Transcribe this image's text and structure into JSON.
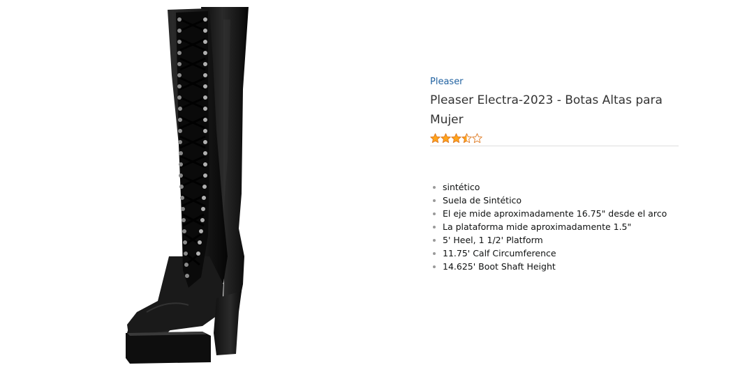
{
  "product": {
    "brand": "Pleaser",
    "title": "Pleaser Electra-2023 - Botas Altas para Mujer",
    "rating": 3.5,
    "rating_max": 5,
    "star_color": "#ffa41c",
    "image_icon": "knee-high-lace-up-platform-boot"
  },
  "features": [
    "sintético",
    "Suela de Sintético",
    "El eje mide aproximadamente 16.75\" desde el arco",
    "La plataforma mide aproximadamente 1.5\"",
    "5' Heel, 1 1/2' Platform",
    "11.75' Calf Circumference",
    "14.625' Boot Shaft Height"
  ]
}
